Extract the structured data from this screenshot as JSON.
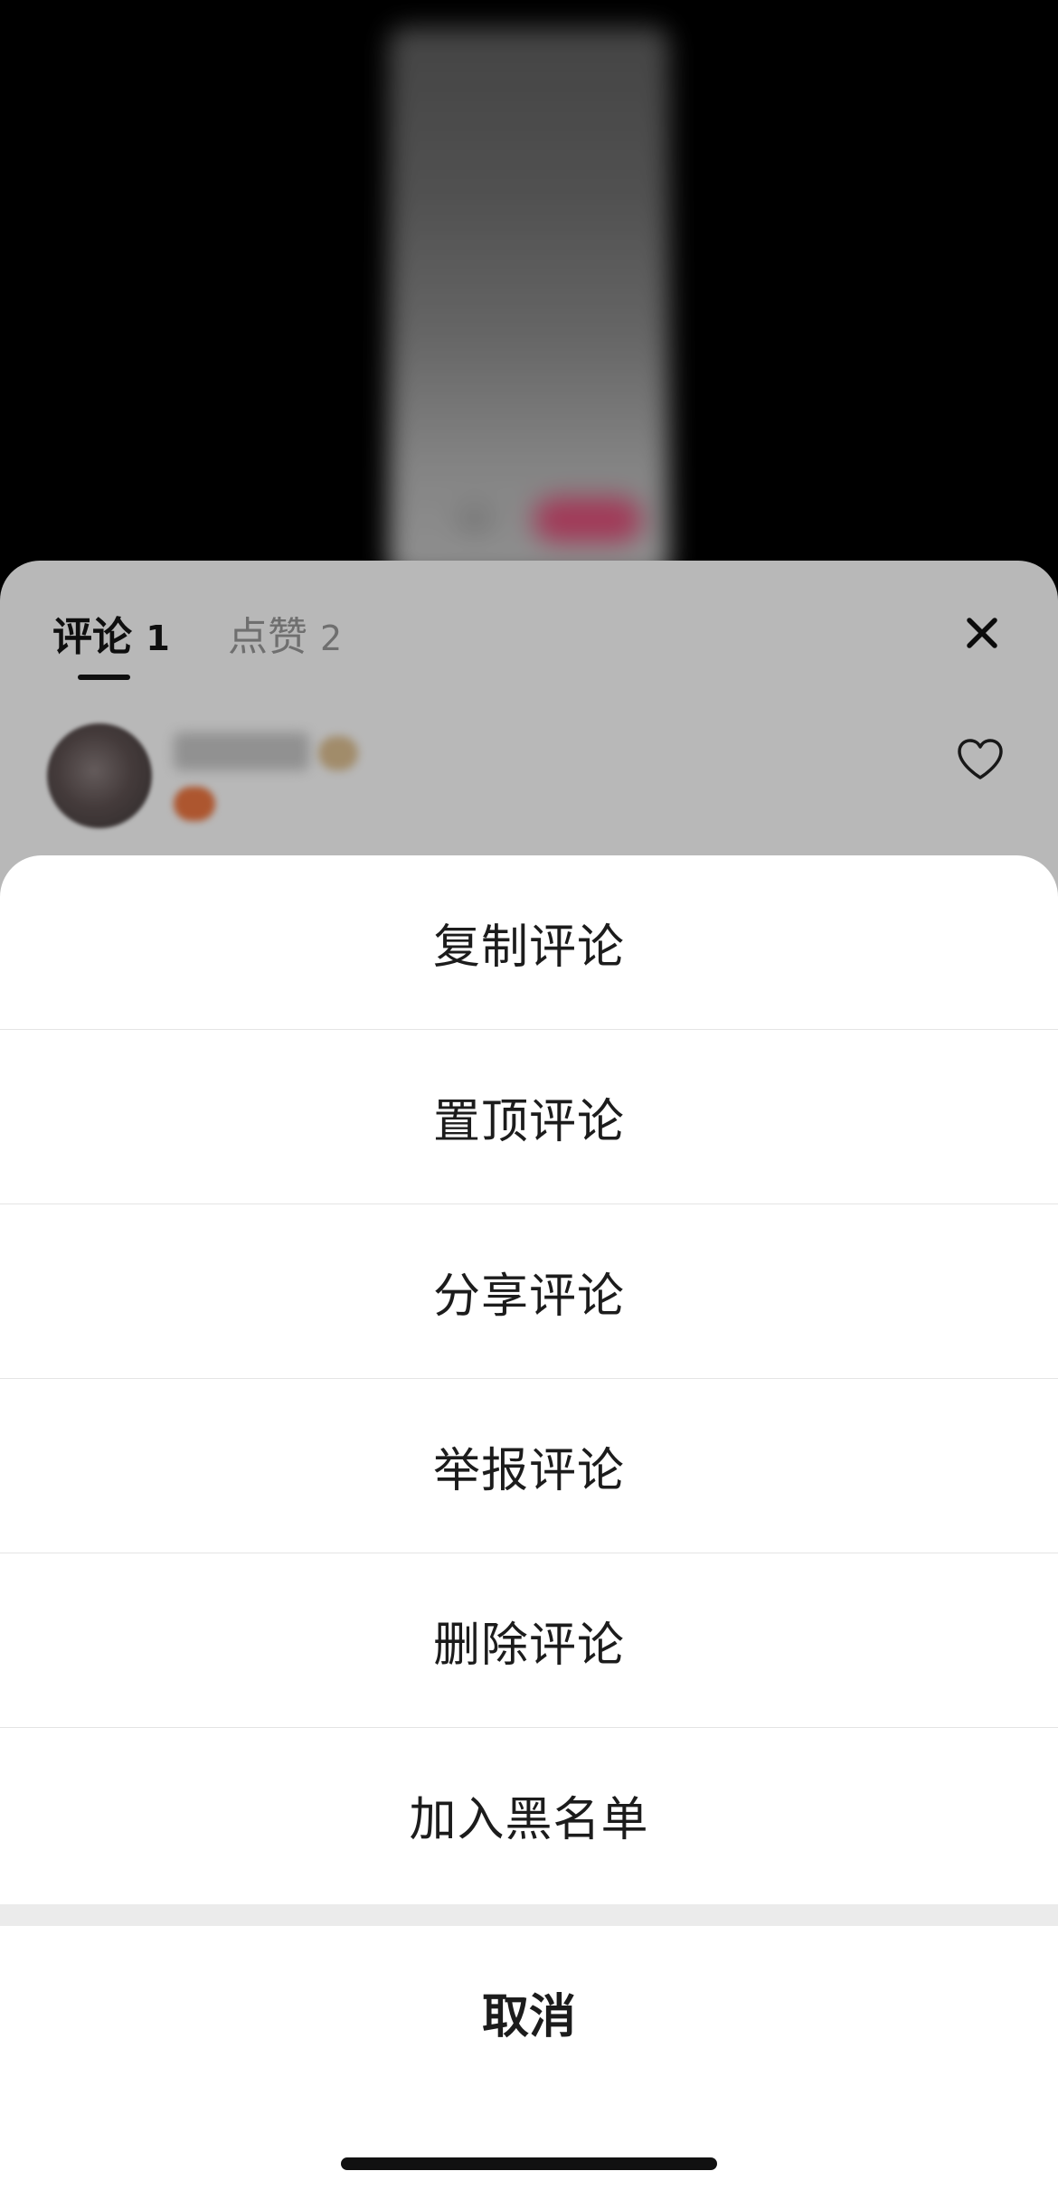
{
  "comment_panel": {
    "tabs": [
      {
        "label": "评论",
        "count": "1"
      },
      {
        "label": "点赞",
        "count": "2"
      }
    ],
    "close_icon": "close-icon",
    "comment": {
      "like_icon": "heart-outline-icon"
    }
  },
  "action_sheet": {
    "items": [
      {
        "label": "复制评论"
      },
      {
        "label": "置顶评论"
      },
      {
        "label": "分享评论"
      },
      {
        "label": "举报评论"
      },
      {
        "label": "删除评论"
      },
      {
        "label": "加入黑名单"
      }
    ],
    "cancel_label": "取消"
  },
  "colors": {
    "accent_pink": "#e0507a",
    "text_primary": "#1c1c1c",
    "text_secondary": "#9a9a9a",
    "divider": "#e4e4e4"
  }
}
